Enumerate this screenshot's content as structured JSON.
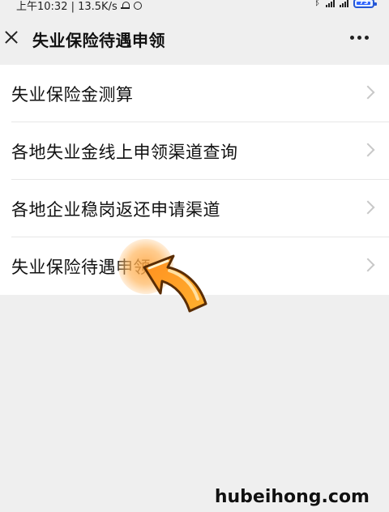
{
  "status_bar": {
    "time_network": "上午10:32 | 13.5K/s",
    "battery": "73"
  },
  "header": {
    "title": "失业保险待遇申领"
  },
  "menu": {
    "items": [
      {
        "label": "失业保险金测算"
      },
      {
        "label": "各地失业金线上申领渠道查询"
      },
      {
        "label": "各地企业稳岗返还申请渠道"
      },
      {
        "label": "失业保险待遇申领"
      }
    ]
  },
  "watermark": "hubeihong.com",
  "colors": {
    "background": "#efefef",
    "card": "#ffffff",
    "text": "#111111",
    "chevron": "#c8c8c8",
    "highlight_orange": "#ff9a2f",
    "battery_blue": "#2d63ff"
  },
  "icons": {
    "close": "close-icon",
    "more": "more-icon",
    "chevron": "chevron-right-icon",
    "bell": "mute-bell-icon",
    "alarm": "alarm-icon",
    "bluetooth": "bluetooth-icon",
    "signal": "signal-icon",
    "battery": "battery-icon",
    "arrow": "arrow-pointer-icon"
  }
}
